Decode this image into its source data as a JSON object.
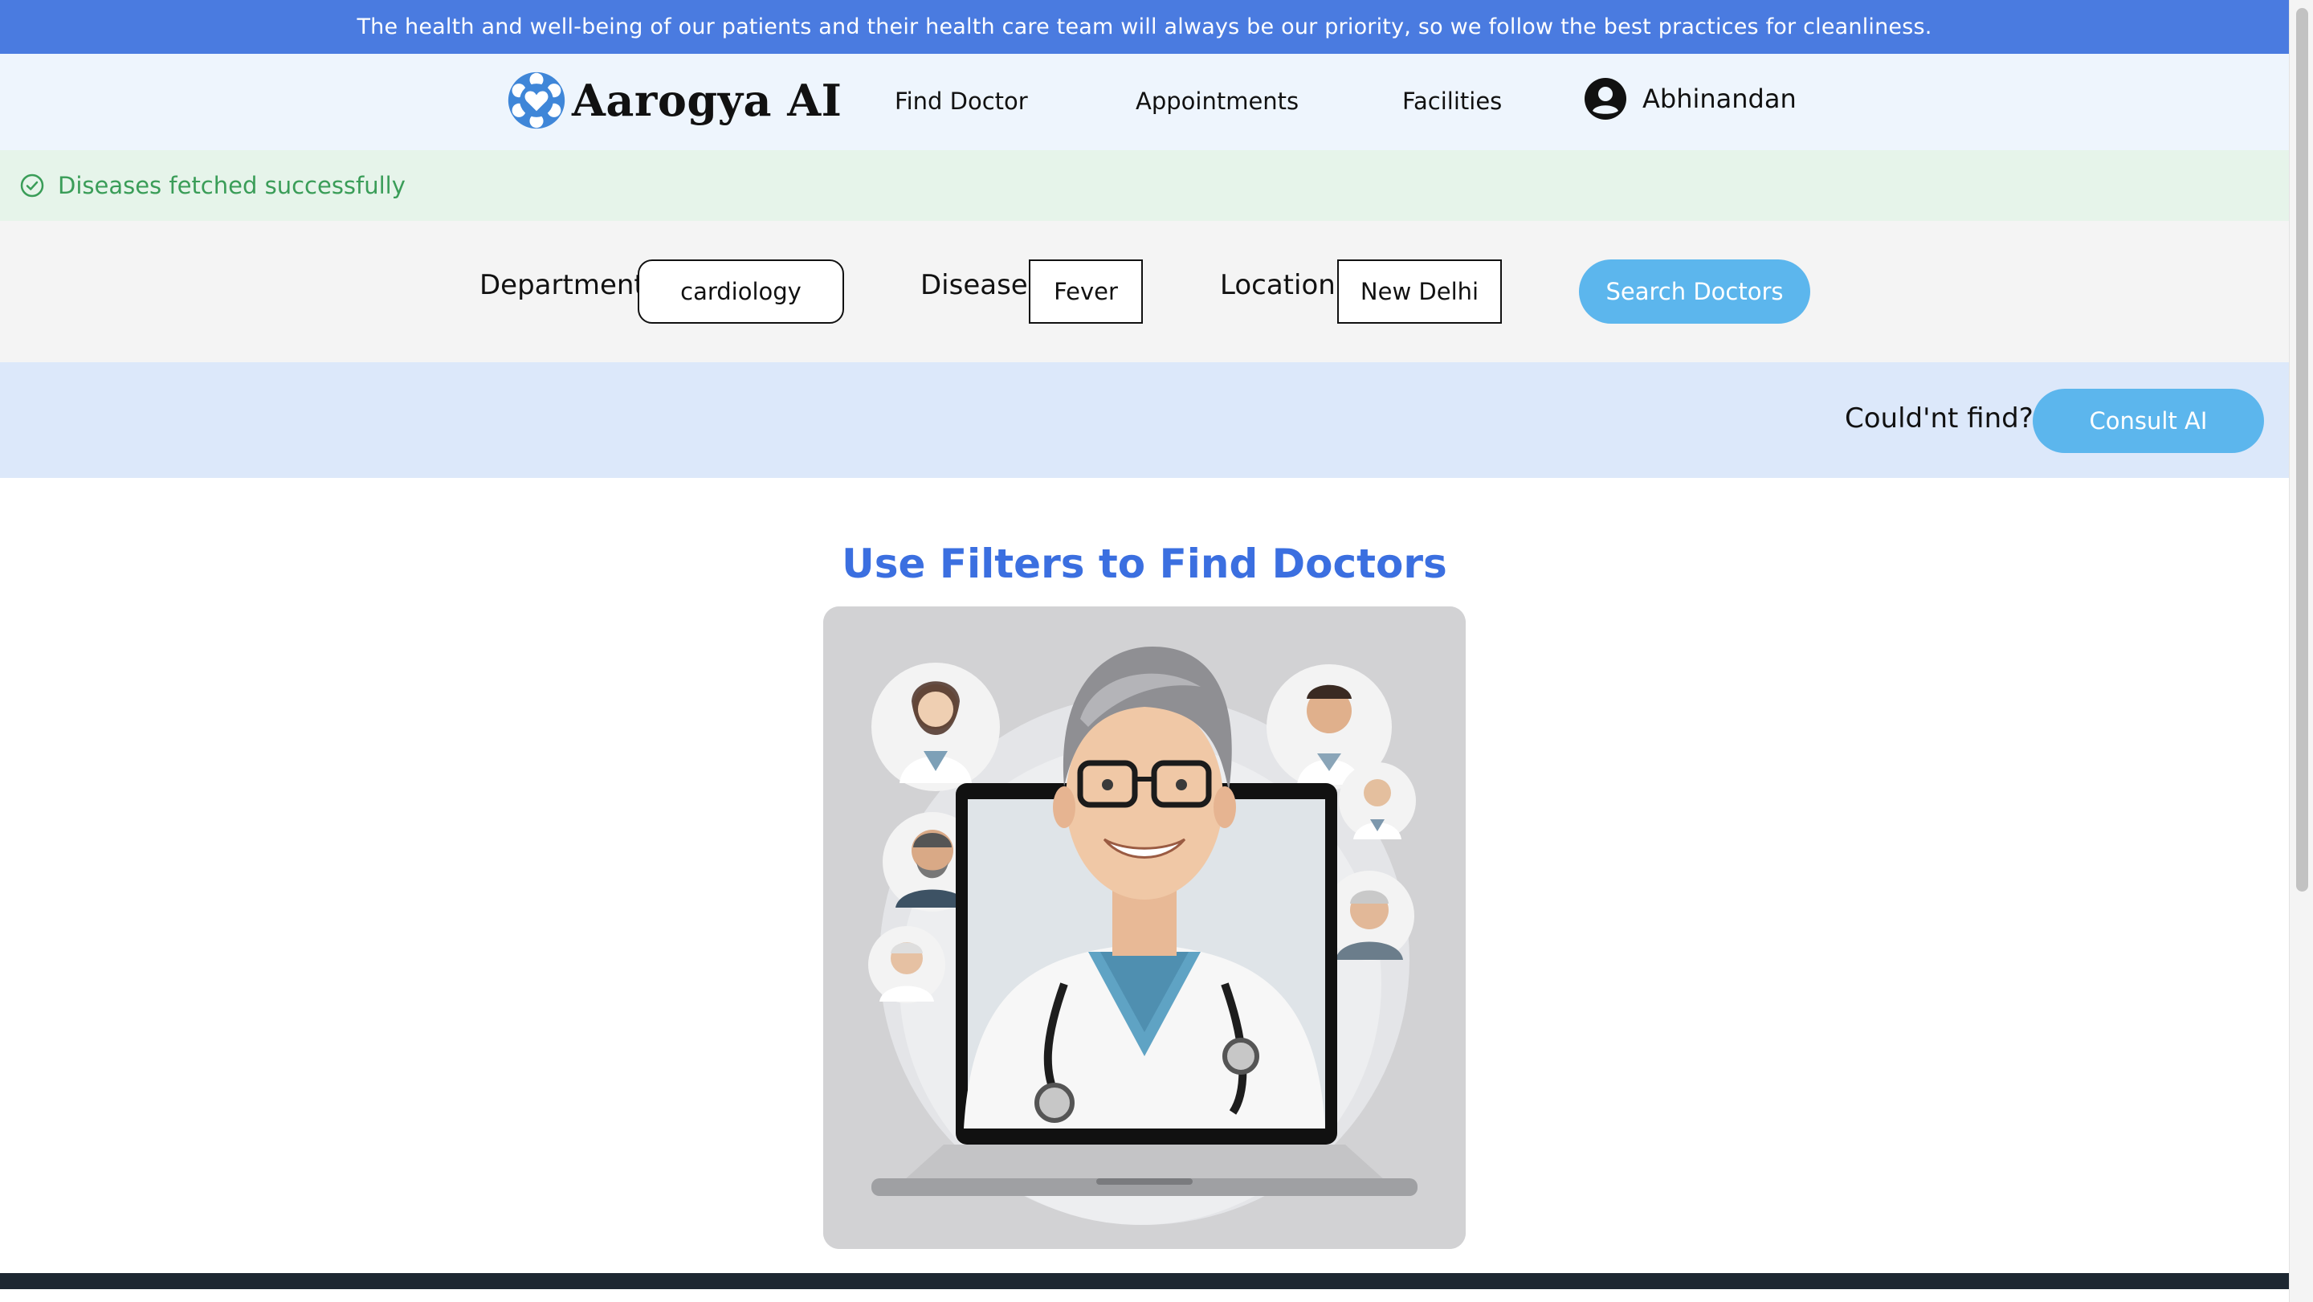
{
  "announcement": "The health and well-being of our patients and their health care team will always be our priority, so we follow the best practices for cleanliness.",
  "brand": {
    "name": "Aarogya AI"
  },
  "nav": {
    "links": [
      "Find Doctor",
      "Appointments",
      "Facilities"
    ],
    "user": "Abhinandan"
  },
  "toast": {
    "message": "Diseases fetched successfully"
  },
  "filters": {
    "department_label": "Department",
    "department_value": "cardiology",
    "disease_label": "Disease",
    "disease_value": "Fever",
    "location_label": "Location",
    "location_value": "New Delhi",
    "search_button": "Search Doctors"
  },
  "consult": {
    "prompt": "Could'nt find?",
    "button": "Consult AI"
  },
  "main": {
    "title": "Use Filters to Find Doctors"
  },
  "colors": {
    "announce_bg": "#4a7be0",
    "nav_bg": "#eef5fd",
    "toast_bg": "#e6f4ea",
    "toast_text": "#3a9d58",
    "filters_bg": "#f4f4f4",
    "consult_bg": "#dce8fa",
    "accent_button": "#5cb6ed",
    "title_blue": "#3b6fe0"
  },
  "icons": {
    "logo": "heart-in-gear-logo",
    "user": "user-circle-icon",
    "toast": "check-circle-icon"
  }
}
